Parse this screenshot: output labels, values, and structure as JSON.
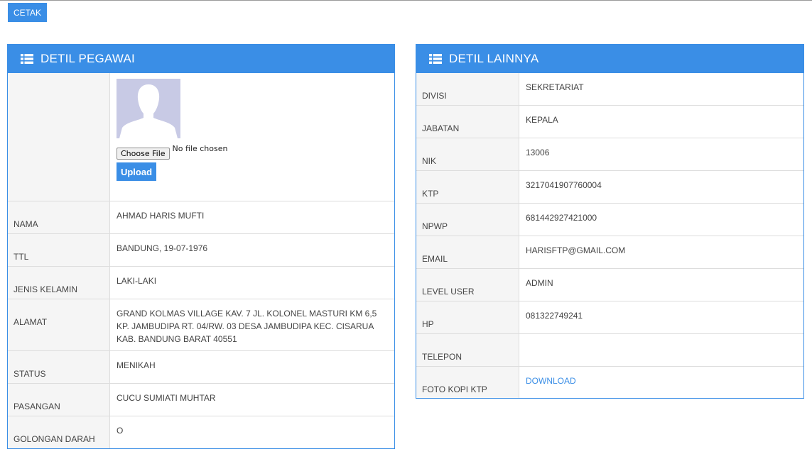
{
  "toolbar": {
    "print_label": "CETAK"
  },
  "left_panel": {
    "title": "DETIL PEGAWAI",
    "photo": {
      "choose_label": "Choose File",
      "no_file_text": "No file chosen",
      "upload_label": "Upload"
    },
    "rows": [
      {
        "label": "NAMA",
        "value": "AHMAD HARIS MUFTI"
      },
      {
        "label": "TTL",
        "value": "BANDUNG, 19-07-1976"
      },
      {
        "label": "JENIS KELAMIN",
        "value": "LAKI-LAKI"
      },
      {
        "label": "ALAMAT",
        "value": "GRAND KOLMAS VILLAGE KAV. 7 JL. KOLONEL MASTURI KM 6,5 KP. JAMBUDIPA RT. 04/RW. 03 DESA JAMBUDIPA KEC. CISARUA KAB. BANDUNG BARAT 40551"
      },
      {
        "label": "STATUS",
        "value": "MENIKAH"
      },
      {
        "label": "PASANGAN",
        "value": "CUCU SUMIATI MUHTAR"
      },
      {
        "label": "GOLONGAN DARAH",
        "value": "O"
      }
    ]
  },
  "right_panel": {
    "title": "DETIL LAINNYA",
    "rows": [
      {
        "label": "DIVISI",
        "value": "SEKRETARIAT"
      },
      {
        "label": "JABATAN",
        "value": "KEPALA"
      },
      {
        "label": "NIK",
        "value": "13006"
      },
      {
        "label": "KTP",
        "value": "3217041907760004"
      },
      {
        "label": "NPWP",
        "value": "681442927421000"
      },
      {
        "label": "EMAIL",
        "value": "HARISFTP@GMAIL.COM"
      },
      {
        "label": "LEVEL USER",
        "value": "ADMIN"
      },
      {
        "label": "HP",
        "value": "081322749241"
      },
      {
        "label": "TELEPON",
        "value": ""
      },
      {
        "label": "FOTO KOPI KTP",
        "value": "DOWNLOAD"
      }
    ]
  },
  "colors": {
    "accent": "#3a8ee6",
    "label_bg": "#f5f5f5",
    "border": "#dddddd",
    "avatar_bg": "#c8cae5"
  },
  "icons": {
    "panel_header": "table-list-icon",
    "avatar": "user-silhouette-icon"
  }
}
